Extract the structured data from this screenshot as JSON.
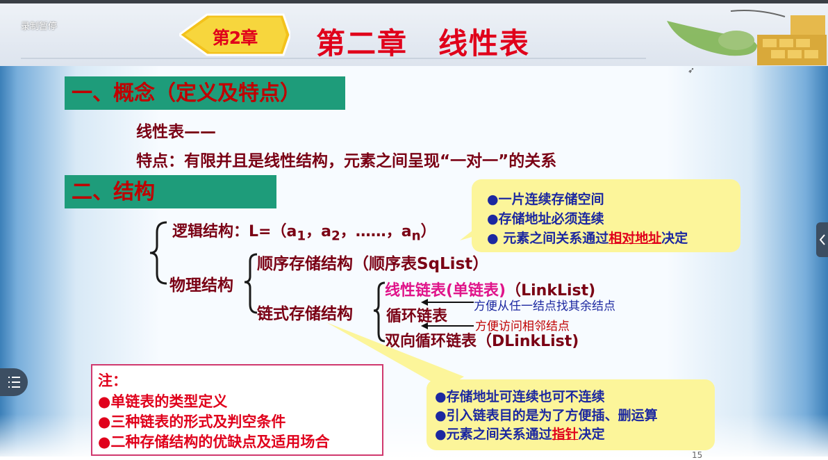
{
  "header": {
    "recording_status": "录制暂停",
    "chapter_badge": "第2章",
    "slide_title": "第二章　线性表"
  },
  "section1": {
    "heading": "一、概念（定义及特点）",
    "definition": "线性表——",
    "feature": "特点：有限并且是线性结构，元素之间呈现“一对一”的关系"
  },
  "section2": {
    "heading": "二、结构",
    "logical": {
      "label": "逻辑结构：",
      "formula_prefix": "L=（a",
      "sub1": "1",
      "sep1": "，a",
      "sub2": "2",
      "mid": "，……，a",
      "subn": "n",
      "end": "）"
    },
    "physical": "物理结构",
    "sequential": "顺序存储结构（顺序表SqList）",
    "linked": "链式存储结构",
    "linked_types": {
      "singly_a": "线性链表(单链表)",
      "singly_b": "（LinkList)",
      "circular": "循环链表",
      "doubly": "双向循环链表（DLinkList)"
    },
    "circular_note": "方便从任一结点找其余结点",
    "doubly_note": "方便访问相邻结点"
  },
  "bubble_top": {
    "line1": "●一片连续存储空间",
    "line2": "●存储地址必须连续",
    "line3_prefix": "● 元素之间关系通过",
    "line3_highlight": "相对地址",
    "line3_suffix": "决定"
  },
  "bubble_bottom": {
    "line1": "●存储地址可连续也可不连续",
    "line2": "●引入链表目的是为了方便插、删运算",
    "line3_prefix": "●元素之间关系通过",
    "line3_highlight": "指针",
    "line3_suffix": "决定"
  },
  "note": {
    "title": "注：",
    "items": [
      "●单链表的类型定义",
      "●三种链表的形式及判空条件",
      "●二种存储结构的优缺点及适用场合"
    ]
  },
  "page_number": "15",
  "colors": {
    "title_red": "#e0001b",
    "section_green": "#1e9c7a",
    "maroon": "#7a0014",
    "pink": "#e0148a",
    "blue": "#1c28a0",
    "bubble_yellow": "#fcf59a"
  }
}
